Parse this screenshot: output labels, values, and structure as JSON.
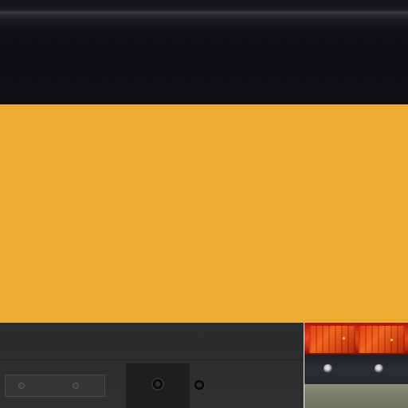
{
  "image": {
    "kind": "vehicle texture sheet",
    "colors": {
      "top_band": "#0e0f12",
      "yellow_panel": "#ebac31",
      "bottom_band": "#2c2d2f",
      "tail_light": "#d43413",
      "bolt_strip": "#2b2e33",
      "bumper_strip": "#7d806e"
    },
    "icons": [
      "bolt-icon",
      "tail-light-icon"
    ]
  }
}
